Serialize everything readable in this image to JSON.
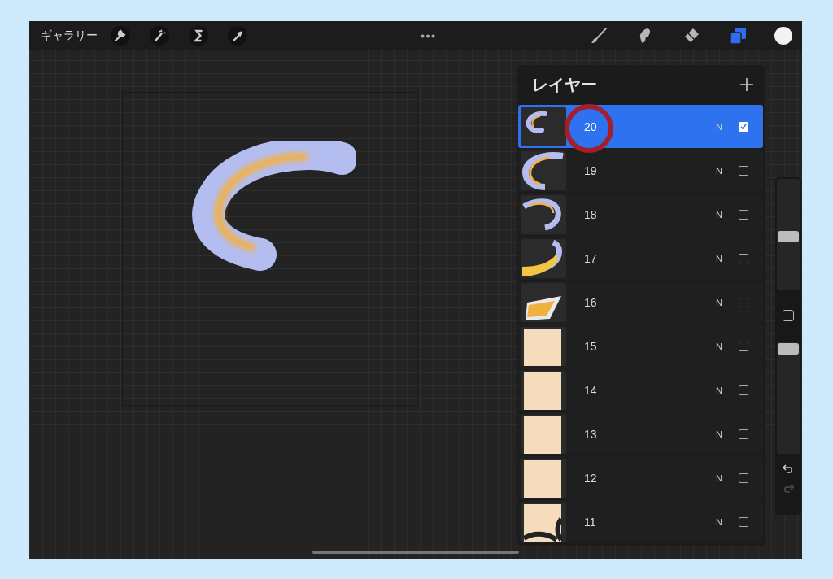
{
  "toolbar": {
    "gallery": "ギャラリー",
    "left_tools": [
      {
        "kind": "wrench"
      },
      {
        "kind": "wand"
      },
      {
        "kind": "selection"
      },
      {
        "kind": "arrow"
      }
    ],
    "right_tools": [
      {
        "kind": "brush",
        "selected": false
      },
      {
        "kind": "smudge",
        "selected": false
      },
      {
        "kind": "eraser",
        "selected": false
      },
      {
        "kind": "layers",
        "selected": true
      },
      {
        "kind": "color",
        "selected": false
      }
    ]
  },
  "layers_panel": {
    "title": "レイヤー",
    "layers": [
      {
        "name": "20",
        "kind": "stroke-small",
        "blend": "N",
        "visible": true,
        "selected": true
      },
      {
        "name": "19",
        "kind": "stroke",
        "blend": "N",
        "visible": false,
        "selected": false
      },
      {
        "name": "18",
        "kind": "hook",
        "blend": "N",
        "visible": false,
        "selected": false
      },
      {
        "name": "17",
        "kind": "hook-yellow",
        "blend": "N",
        "visible": false,
        "selected": false
      },
      {
        "name": "16",
        "kind": "shape",
        "blend": "N",
        "visible": false,
        "selected": false
      },
      {
        "name": "15",
        "kind": "fill",
        "blend": "N",
        "visible": false,
        "selected": false
      },
      {
        "name": "14",
        "kind": "fill",
        "blend": "N",
        "visible": false,
        "selected": false
      },
      {
        "name": "13",
        "kind": "fill",
        "blend": "N",
        "visible": false,
        "selected": false
      },
      {
        "name": "12",
        "kind": "fill",
        "blend": "N",
        "visible": false,
        "selected": false
      },
      {
        "name": "11",
        "kind": "fill-edge",
        "blend": "N",
        "visible": false,
        "selected": false
      }
    ]
  },
  "sidebar": {
    "sliders": [
      {
        "level": 0.47
      },
      {
        "level": 0.99
      }
    ],
    "buttons": [
      {
        "kind": "undo",
        "disabled": false
      },
      {
        "kind": "redo",
        "disabled": true
      }
    ]
  }
}
